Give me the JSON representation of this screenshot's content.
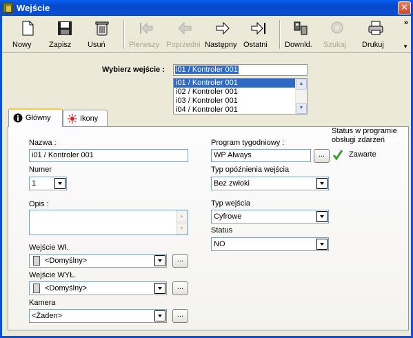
{
  "window": {
    "title": "Wejście",
    "close_label": "✕"
  },
  "toolbar": {
    "buttons": [
      {
        "label": "Nowy",
        "icon": "new-document-icon",
        "enabled": true
      },
      {
        "label": "Zapisz",
        "icon": "floppy-disk-icon",
        "enabled": true
      },
      {
        "label": "Usuń",
        "icon": "trash-icon",
        "enabled": true
      },
      {
        "label": "Pierwszy",
        "icon": "first-arrow-icon",
        "enabled": false
      },
      {
        "label": "Poprzedni",
        "icon": "prev-arrow-icon",
        "enabled": false
      },
      {
        "label": "Następny",
        "icon": "next-arrow-icon",
        "enabled": true
      },
      {
        "label": "Ostatni",
        "icon": "last-arrow-icon",
        "enabled": true
      },
      {
        "label": "Downld.",
        "icon": "download-icon",
        "enabled": true
      },
      {
        "label": "Szukaj",
        "icon": "search-icon",
        "enabled": false
      },
      {
        "label": "Drukuj",
        "icon": "printer-icon",
        "enabled": true
      }
    ],
    "overflow_label": "»"
  },
  "selector": {
    "label": "Wybierz wejście :",
    "value": "i01 / Kontroler 001",
    "options": [
      "i01 / Kontroler 001",
      "i02 / Kontroler 001",
      "i03 / Kontroler 001",
      "i04 / Kontroler 001"
    ],
    "selected_index": 0
  },
  "tabs": [
    {
      "label": "Główny",
      "icon": "info-icon",
      "active": true
    },
    {
      "label": "Ikony",
      "icon": "light-icon",
      "active": false
    }
  ],
  "form": {
    "name_label": "Nazwa :",
    "name_value": "i01 / Kontroler 001",
    "number_label": "Numer",
    "number_value": "1",
    "description_label": "Opis :",
    "input_on_label": "Wejście Wł.",
    "input_on_value": "<Domyślny>",
    "input_off_label": "Wejście WYŁ.",
    "input_off_value": "<Domyślny>",
    "camera_label": "Kamera",
    "camera_value": "<Żaden>",
    "weekly_program_label": "Program tygodniowy :",
    "weekly_program_value": "WP Always",
    "input_delay_type_label": "Typ opóźnienia wejścia",
    "input_delay_type_value": "Bez zwłoki",
    "input_type_label": "Typ wejścia",
    "input_type_value": "Cyfrowe",
    "status_label": "Status",
    "status_value": "NO",
    "event_status_label": "Status w programie obsługi zdarzeń",
    "event_status_value": "Zawarte",
    "dots_label": "..."
  },
  "colors": {
    "titlebar": "#0a50d8",
    "selection": "#316ac5",
    "check": "#3aa02a"
  }
}
